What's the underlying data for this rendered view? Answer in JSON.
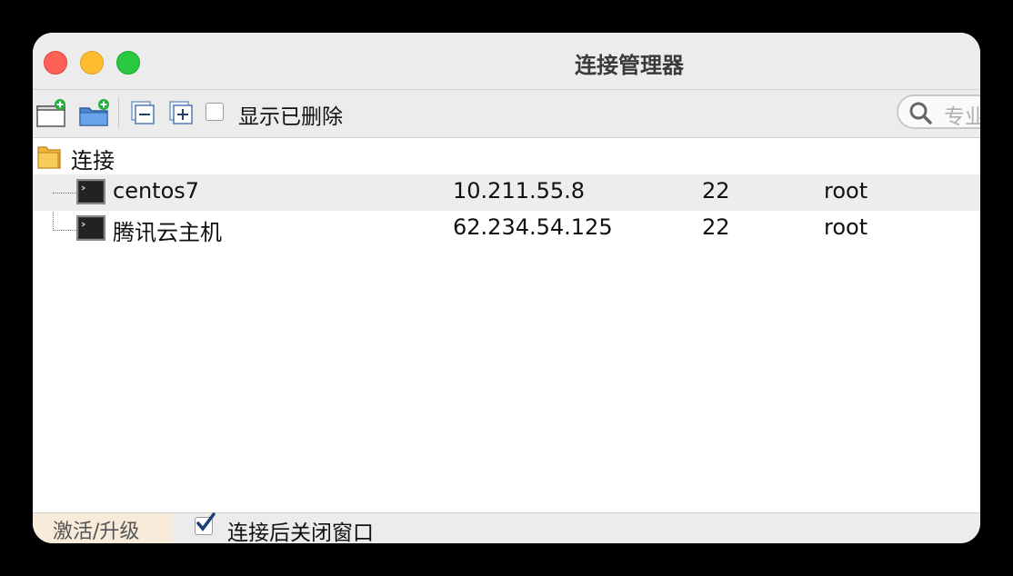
{
  "window": {
    "title": "连接管理器"
  },
  "toolbar": {
    "buttons": [
      {
        "icon": "new-connection-icon"
      },
      {
        "icon": "new-folder-icon"
      },
      {
        "icon": "collapse-all-icon"
      },
      {
        "icon": "expand-all-icon"
      }
    ],
    "show_deleted_label": "显示已删除",
    "show_deleted_checked": false,
    "search_placeholder": "专业"
  },
  "tree": {
    "folder_label": "连接",
    "connections": [
      {
        "name": "centos7",
        "host": "10.211.55.8",
        "port": "22",
        "user": "root",
        "selected": true
      },
      {
        "name": "腾讯云主机",
        "host": "62.234.54.125",
        "port": "22",
        "user": "root",
        "selected": false
      }
    ]
  },
  "bottombar": {
    "activate_label": "激活/升级",
    "close_after_connect_label": "连接后关闭窗口",
    "close_after_connect_checked": true
  },
  "colors": {
    "close": "#fe5f57",
    "minimize": "#febc2e",
    "maximize": "#28c840",
    "selection": "#ededed",
    "activate_bg": "#f8ebd9"
  }
}
